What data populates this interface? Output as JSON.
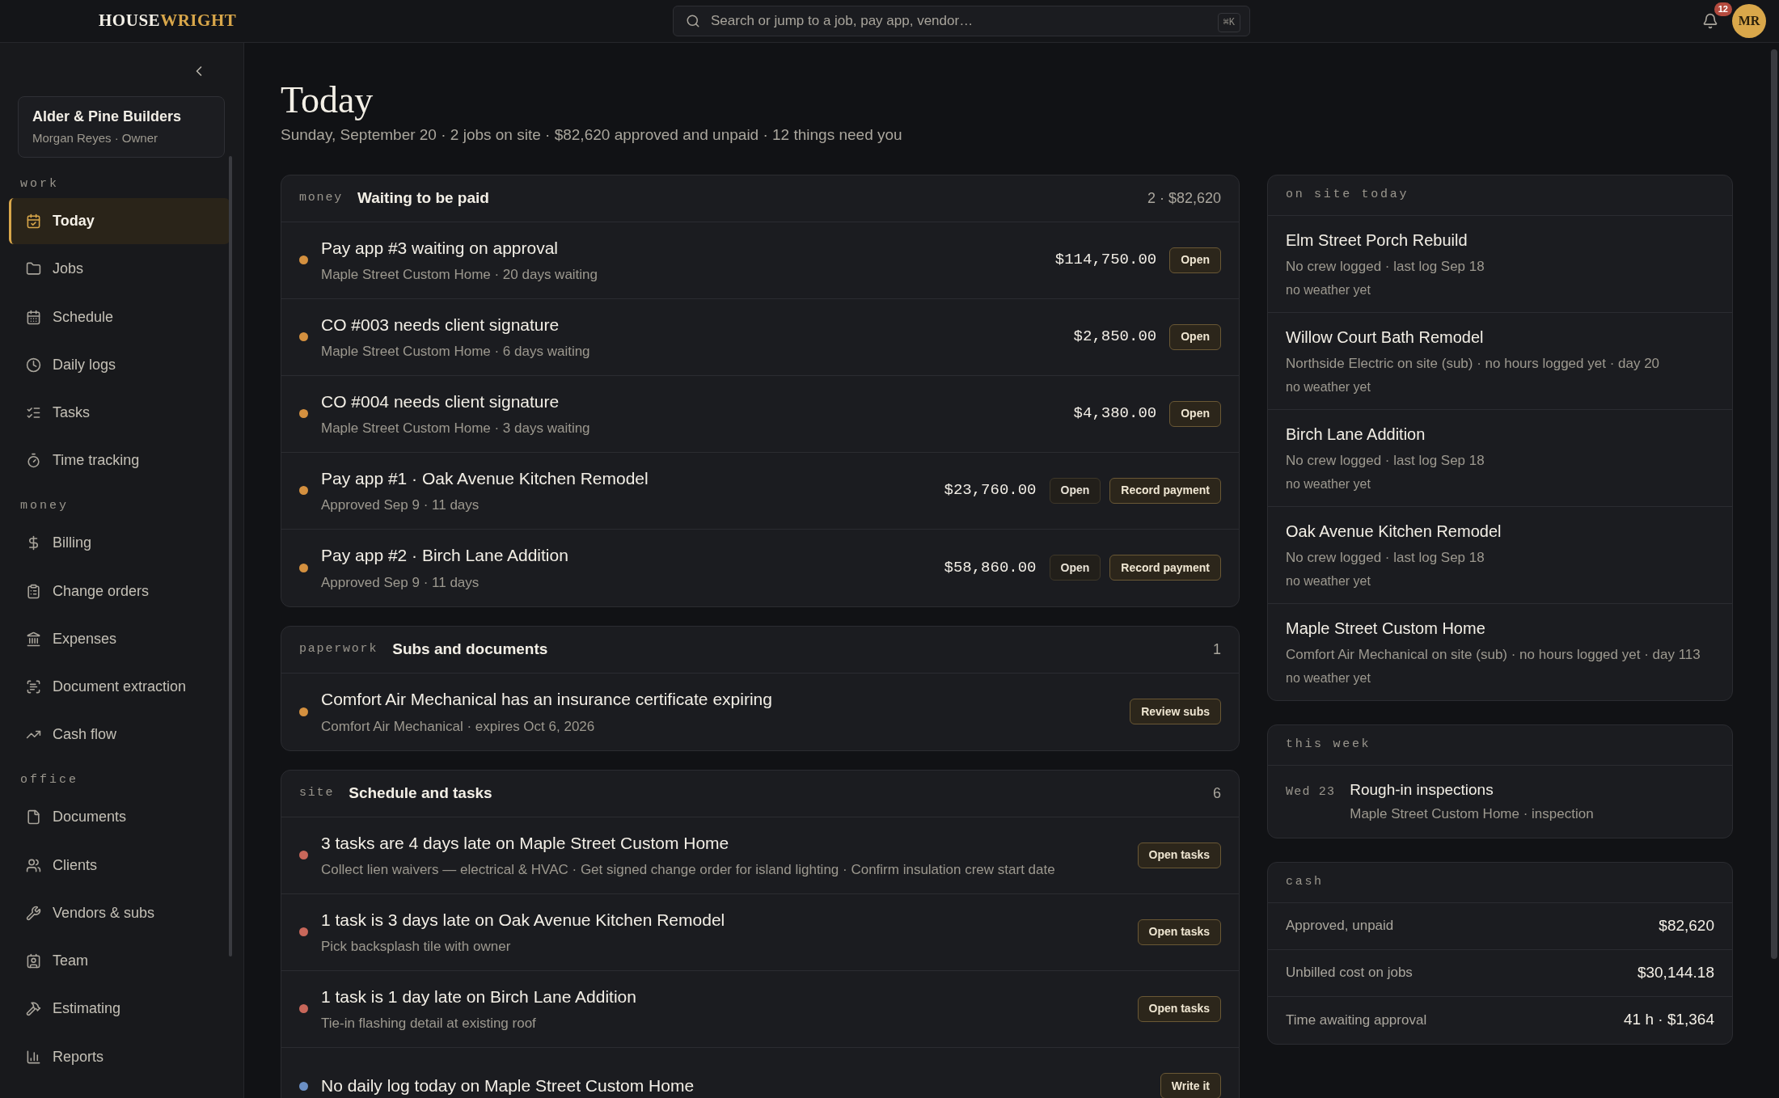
{
  "topbar": {
    "logo_main": "HOUSE",
    "logo_accent": "WRIGHT",
    "search": {
      "placeholder": "Search or jump to a job, pay app, vendor…",
      "shortcut": "⌘K"
    },
    "notifications": "12",
    "avatar": "MR"
  },
  "sidebar": {
    "company": "Alder & Pine Builders",
    "user": "Morgan Reyes · Owner",
    "sections": [
      {
        "label": "work",
        "items": [
          {
            "label": "Today",
            "selected": true
          },
          {
            "label": "Jobs",
            "selected": false
          },
          {
            "label": "Schedule",
            "selected": false
          },
          {
            "label": "Daily logs",
            "selected": false
          },
          {
            "label": "Tasks",
            "selected": false
          },
          {
            "label": "Time tracking",
            "selected": false
          }
        ]
      },
      {
        "label": "money",
        "items": [
          {
            "label": "Billing",
            "selected": false
          },
          {
            "label": "Change orders",
            "selected": false
          },
          {
            "label": "Expenses",
            "selected": false
          },
          {
            "label": "Document extraction",
            "selected": false
          },
          {
            "label": "Cash flow",
            "selected": false
          }
        ]
      },
      {
        "label": "office",
        "items": [
          {
            "label": "Documents",
            "selected": false
          },
          {
            "label": "Clients",
            "selected": false
          },
          {
            "label": "Vendors & subs",
            "selected": false
          },
          {
            "label": "Team",
            "selected": false
          },
          {
            "label": "Estimating",
            "selected": false
          },
          {
            "label": "Reports",
            "selected": false
          }
        ]
      }
    ]
  },
  "page": {
    "title": "Today",
    "subtitle": "Sunday, September 20 · 2 jobs on site · $82,620 approved and unpaid · 12 things need you"
  },
  "sections": [
    {
      "tag": "money",
      "title": "Waiting to be paid",
      "count": "2 · $82,620",
      "rows": [
        {
          "color": "#d4903f",
          "title": "Pay app #3 waiting on approval",
          "detail": "Maple Street Custom Home · 20 days waiting",
          "amount": "$114,750.00",
          "buttons": [
            {
              "label": "Open",
              "kind": "primary"
            }
          ]
        },
        {
          "color": "#d4903f",
          "title": "CO #003 needs client signature",
          "detail": "Maple Street Custom Home · 6 days waiting",
          "amount": "$2,850.00",
          "buttons": [
            {
              "label": "Open",
              "kind": "primary"
            }
          ]
        },
        {
          "color": "#d4903f",
          "title": "CO #004 needs client signature",
          "detail": "Maple Street Custom Home · 3 days waiting",
          "amount": "$4,380.00",
          "buttons": [
            {
              "label": "Open",
              "kind": "primary"
            }
          ]
        },
        {
          "color": "#d4903f",
          "title": "Pay app #1 · Oak Avenue Kitchen Remodel",
          "detail": "Approved Sep 9 · 11 days",
          "amount": "$23,760.00",
          "buttons": [
            {
              "label": "Open",
              "kind": "secondary"
            },
            {
              "label": "Record payment",
              "kind": "primary"
            }
          ]
        },
        {
          "color": "#d4903f",
          "title": "Pay app #2 · Birch Lane Addition",
          "detail": "Approved Sep 9 · 11 days",
          "amount": "$58,860.00",
          "buttons": [
            {
              "label": "Open",
              "kind": "secondary"
            },
            {
              "label": "Record payment",
              "kind": "primary"
            }
          ]
        }
      ]
    },
    {
      "tag": "paperwork",
      "title": "Subs and documents",
      "count": "1",
      "rows": [
        {
          "color": "#d4903f",
          "title": "Comfort Air Mechanical has an insurance certificate expiring",
          "detail": "Comfort Air Mechanical · expires Oct 6, 2026",
          "buttons": [
            {
              "label": "Review subs",
              "kind": "primary"
            }
          ]
        }
      ]
    },
    {
      "tag": "site",
      "title": "Schedule and tasks",
      "count": "6",
      "rows": [
        {
          "color": "#c8675a",
          "title": "3 tasks are 4 days late on Maple Street Custom Home",
          "detail": "Collect lien waivers — electrical & HVAC · Get signed change order for island lighting · Confirm insulation crew start date",
          "buttons": [
            {
              "label": "Open tasks",
              "kind": "primary"
            }
          ]
        },
        {
          "color": "#c8675a",
          "title": "1 task is 3 days late on Oak Avenue Kitchen Remodel",
          "detail": "Pick backsplash tile with owner",
          "buttons": [
            {
              "label": "Open tasks",
              "kind": "primary"
            }
          ]
        },
        {
          "color": "#c8675a",
          "title": "1 task is 1 day late on Birch Lane Addition",
          "detail": "Tie-in flashing detail at existing roof",
          "buttons": [
            {
              "label": "Open tasks",
              "kind": "primary"
            }
          ]
        },
        {
          "color": "#6b8fc4",
          "title": "No daily log today on Maple Street Custom Home",
          "buttons": [
            {
              "label": "Write it",
              "kind": "primary"
            }
          ]
        }
      ]
    }
  ],
  "on_site": {
    "label": "on site today",
    "jobs": [
      {
        "name": "Elm Street Porch Rebuild",
        "detail": "No crew logged · last log Sep 18",
        "weather": "no weather yet"
      },
      {
        "name": "Willow Court Bath Remodel",
        "detail": "Northside Electric on site (sub) · no hours logged yet · day 20",
        "weather": "no weather yet"
      },
      {
        "name": "Birch Lane Addition",
        "detail": "No crew logged · last log Sep 18",
        "weather": "no weather yet"
      },
      {
        "name": "Oak Avenue Kitchen Remodel",
        "detail": "No crew logged · last log Sep 18",
        "weather": "no weather yet"
      },
      {
        "name": "Maple Street Custom Home",
        "detail": "Comfort Air Mechanical on site (sub) · no hours logged yet · day 113",
        "weather": "no weather yet"
      }
    ]
  },
  "this_week": {
    "label": "this week",
    "events": [
      {
        "date": "Wed 23",
        "title": "Rough-in inspections",
        "detail": "Maple Street Custom Home · inspection"
      }
    ]
  },
  "cash": {
    "label": "cash",
    "rows": [
      {
        "label": "Approved, unpaid",
        "value": "$82,620"
      },
      {
        "label": "Unbilled cost on jobs",
        "value": "$30,144.18"
      },
      {
        "label": "Time awaiting approval",
        "value": "41 h · $1,364"
      }
    ]
  }
}
